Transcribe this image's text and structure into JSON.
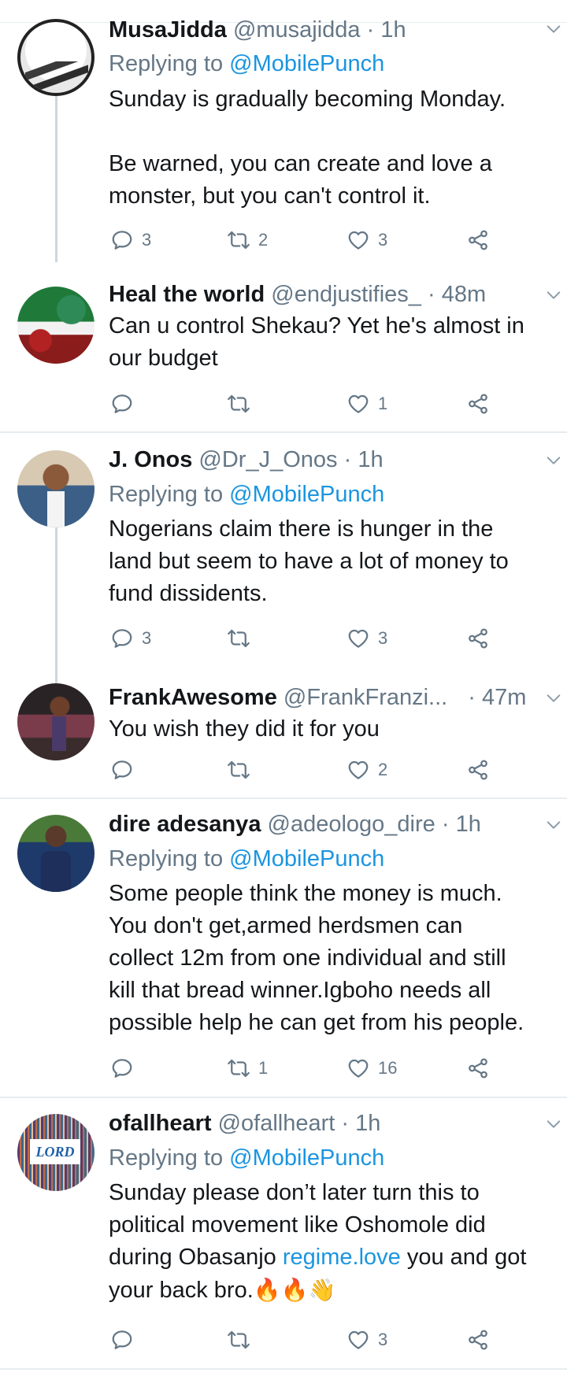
{
  "tweets": [
    {
      "name": "MusaJidda",
      "handle": "@musajidda",
      "time": "· 1h",
      "replying_label": "Replying to",
      "replying_to": "@MobilePunch",
      "text": [
        "Sunday is gradually becoming Monday.",
        "",
        "Be warned, you can create and love a",
        "monster, but you can't control it."
      ],
      "replies": "3",
      "retweets": "2",
      "likes": "3"
    },
    {
      "name": "Heal the world",
      "handle": "@endjustifies_",
      "time": "· 48m",
      "text": [
        "Can u control Shekau? Yet he's almost in",
        "our budget"
      ],
      "replies": "",
      "retweets": "",
      "likes": "1"
    },
    {
      "name": "J. Onos",
      "handle": "@Dr_J_Onos",
      "time": "· 1h",
      "replying_label": "Replying to",
      "replying_to": "@MobilePunch",
      "text": [
        "Nogerians claim there is hunger in the",
        "land but seem to have a lot of money to",
        "fund dissidents."
      ],
      "replies": "3",
      "retweets": "",
      "likes": "3"
    },
    {
      "name": "FrankAwesome",
      "handle": "@FrankFranzi...",
      "time": "· 47m",
      "text": [
        "You wish they did it for you"
      ],
      "replies": "",
      "retweets": "",
      "likes": "2"
    },
    {
      "name": "dire adesanya",
      "handle": "@adeologo_dire",
      "time": "· 1h",
      "replying_label": "Replying to",
      "replying_to": "@MobilePunch",
      "text": [
        "Some people think the money is much.",
        "You don't get,armed herdsmen  can",
        "collect 12m from one individual and still",
        "kill that bread winner.Igboho needs all",
        "possible help he can get from his people."
      ],
      "replies": "",
      "retweets": "1",
      "likes": "16"
    },
    {
      "name": "ofallheart",
      "handle": "@ofallheart",
      "time": "· 1h",
      "replying_label": "Replying to",
      "replying_to": "@MobilePunch",
      "text_lines": {
        "l1": "Sunday please don’t later turn this to",
        "l2": "political movement like Oshomole did",
        "l3a": "during Obasanjo ",
        "l3link": "regime.love",
        "l3b": " you and got",
        "l4": "your back bro.",
        "emojis": "🔥🔥👋"
      },
      "avatar_text": "LORD",
      "replies": "",
      "retweets": "",
      "likes": "3"
    }
  ],
  "icons": {
    "reply": "reply-icon",
    "retweet": "retweet-icon",
    "like": "heart-icon",
    "share": "share-icon",
    "caret": "chevron-down-icon"
  },
  "colors": {
    "text": "#14171a",
    "secondary": "#657786",
    "link": "#1b95e0",
    "divider": "#e6ecf0"
  }
}
